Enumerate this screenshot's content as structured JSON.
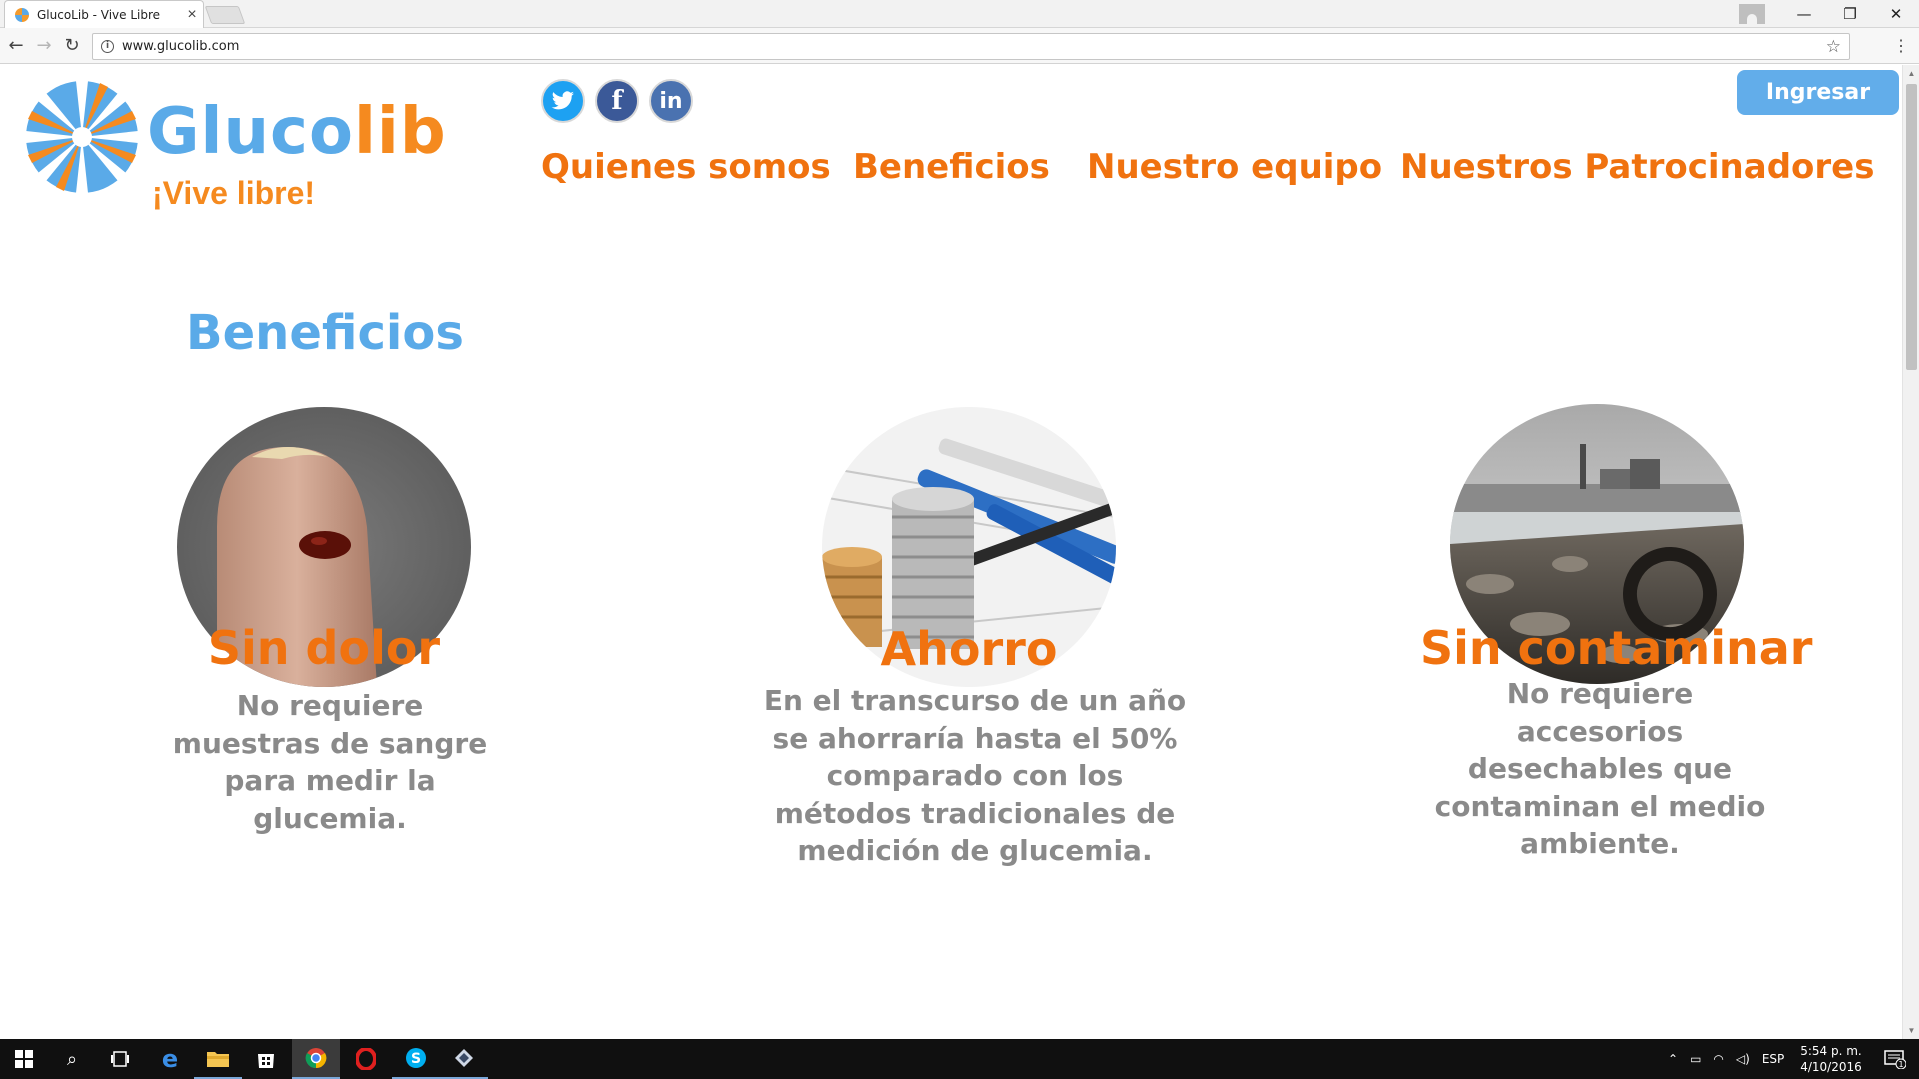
{
  "browser": {
    "tab_title": "GlucoLib - Vive Libre",
    "tab_close": "×",
    "url": "www.glucolib.com",
    "window_controls": {
      "minimize": "—",
      "restore": "❐",
      "close": "✕"
    }
  },
  "header": {
    "logo_gluco": "Gluco",
    "logo_lib": "lib",
    "tagline": "¡Vive libre!",
    "login_button": "Ingresar",
    "social": [
      "twitter-icon",
      "facebook-icon",
      "linkedin-icon"
    ],
    "nav": [
      {
        "label": "Quienes somos"
      },
      {
        "label": "Beneficios"
      },
      {
        "label": "Nuestro equipo"
      },
      {
        "label": "Nuestros Patrocinadores"
      }
    ]
  },
  "main": {
    "section_title": "Beneficios",
    "cards": [
      {
        "title": "Sin dolor",
        "text": "No requiere muestras de sangre para medir la glucemia.",
        "image": "finger-blood-drop"
      },
      {
        "title": "Ahorro",
        "text": "En el transcurso de un año se ahorraría hasta el 50% comparado con los métodos tradicionales de medición de glucemia.",
        "image": "coins-and-pens"
      },
      {
        "title": "Sin contaminar",
        "text": "No requiere accesorios desechables que contaminan el medio ambiente.",
        "image": "polluted-shore"
      }
    ]
  },
  "taskbar": {
    "language": "ESP",
    "time": "5:54 p. m.",
    "date": "4/10/2016",
    "notification_count": "1"
  },
  "colors": {
    "brand_blue": "#5aaae8",
    "brand_orange": "#f0720f",
    "body_gray": "#8a8a8a"
  }
}
